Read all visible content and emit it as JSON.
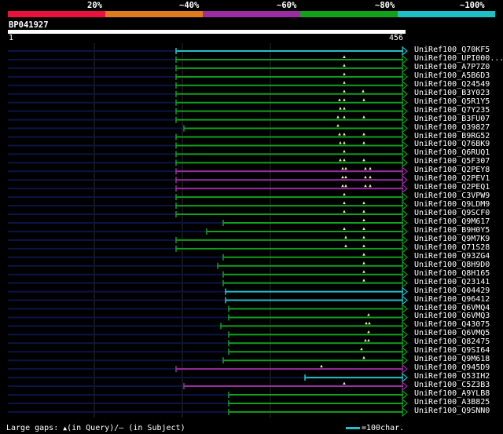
{
  "legend": {
    "colors": [
      "#e8123c",
      "#e07a1e",
      "#9a2ea0",
      "#11a11b",
      "#1fbfc6"
    ],
    "labels": [
      "20%",
      "~40%",
      "~60%",
      "~80%",
      "~100%"
    ]
  },
  "query": {
    "id": "BP041927",
    "start": "1",
    "end": "456"
  },
  "hits": [
    {
      "label": "UniRef100_Q70KF5",
      "start": 224,
      "color": "cyan",
      "marks": []
    },
    {
      "label": "UniRef100_UPI000...",
      "start": 224,
      "color": "green",
      "marks": [
        438
      ]
    },
    {
      "label": "UniRef100_A7P7Z0",
      "start": 224,
      "color": "green",
      "marks": [
        438
      ]
    },
    {
      "label": "UniRef100_A5B6D3",
      "start": 224,
      "color": "green",
      "marks": [
        438
      ]
    },
    {
      "label": "UniRef100_Q24549",
      "start": 224,
      "color": "green",
      "marks": [
        438
      ]
    },
    {
      "label": "UniRef100_B3Y023",
      "start": 224,
      "color": "green",
      "marks": [
        438,
        462
      ]
    },
    {
      "label": "UniRef100_Q5R1Y5",
      "start": 224,
      "color": "green",
      "marks": [
        432,
        438,
        463
      ]
    },
    {
      "label": "UniRef100_Q7Y235",
      "start": 224,
      "color": "green",
      "marks": [
        433,
        438
      ]
    },
    {
      "label": "UniRef100_B3FU07",
      "start": 224,
      "color": "green",
      "marks": [
        430,
        438,
        463
      ]
    },
    {
      "label": "UniRef100_Q39827",
      "start": 234,
      "color": "green",
      "marks": [
        430
      ]
    },
    {
      "label": "UniRef100_B9RG52",
      "start": 224,
      "color": "green",
      "marks": [
        432,
        438,
        463
      ]
    },
    {
      "label": "UniRef100_Q76BK9",
      "start": 224,
      "color": "green",
      "marks": [
        433,
        438,
        463
      ]
    },
    {
      "label": "UniRef100_Q6RUQ1",
      "start": 224,
      "color": "green",
      "marks": [
        438
      ]
    },
    {
      "label": "UniRef100_Q5F307",
      "start": 224,
      "color": "green",
      "marks": [
        433,
        438,
        463
      ]
    },
    {
      "label": "UniRef100_Q2PEY8",
      "start": 224,
      "color": "magenta",
      "marks": [
        436,
        440,
        465,
        471
      ]
    },
    {
      "label": "UniRef100_Q2PEV1",
      "start": 224,
      "color": "magenta",
      "marks": [
        436,
        440,
        465,
        471
      ]
    },
    {
      "label": "UniRef100_Q2PEQ1",
      "start": 224,
      "color": "magenta",
      "marks": [
        436,
        440,
        465,
        471
      ]
    },
    {
      "label": "UniRef100_C3VPW9",
      "start": 224,
      "color": "green",
      "marks": [
        438
      ]
    },
    {
      "label": "UniRef100_Q9LDM9",
      "start": 224,
      "color": "green",
      "marks": [
        438,
        463
      ]
    },
    {
      "label": "UniRef100_Q9SCF0",
      "start": 224,
      "color": "green",
      "marks": [
        438,
        463
      ]
    },
    {
      "label": "UniRef100_Q9M617",
      "start": 284,
      "color": "green",
      "marks": [
        463
      ]
    },
    {
      "label": "UniRef100_B9H0Y5",
      "start": 263,
      "color": "green",
      "marks": [
        438,
        463
      ]
    },
    {
      "label": "UniRef100_Q9M7K9",
      "start": 224,
      "color": "green",
      "marks": [
        440,
        463
      ]
    },
    {
      "label": "UniRef100_Q71S28",
      "start": 224,
      "color": "green",
      "marks": [
        440,
        463
      ]
    },
    {
      "label": "UniRef100_Q93ZG4",
      "start": 284,
      "color": "green",
      "marks": [
        463
      ]
    },
    {
      "label": "UniRef100_Q8H9D0",
      "start": 277,
      "color": "green",
      "marks": [
        463
      ]
    },
    {
      "label": "UniRef100_Q8H165",
      "start": 284,
      "color": "green",
      "marks": [
        463
      ]
    },
    {
      "label": "UniRef100_Q23141",
      "start": 284,
      "color": "green",
      "marks": [
        463
      ]
    },
    {
      "label": "UniRef100_Q04429",
      "start": 287,
      "color": "cyan",
      "marks": []
    },
    {
      "label": "UniRef100_Q96412",
      "start": 287,
      "color": "cyan",
      "marks": []
    },
    {
      "label": "UniRef100_Q6VMQ4",
      "start": 291,
      "color": "green",
      "marks": []
    },
    {
      "label": "UniRef100_Q6VMQ3",
      "start": 291,
      "color": "green",
      "marks": [
        469
      ]
    },
    {
      "label": "UniRef100_Q43075",
      "start": 281,
      "color": "green",
      "marks": [
        466,
        470
      ]
    },
    {
      "label": "UniRef100_Q6VMQ5",
      "start": 291,
      "color": "green",
      "marks": [
        469
      ]
    },
    {
      "label": "UniRef100_Q82475",
      "start": 291,
      "color": "green",
      "marks": [
        465,
        469
      ]
    },
    {
      "label": "UniRef100_Q9SI64",
      "start": 291,
      "color": "green",
      "marks": [
        460
      ]
    },
    {
      "label": "UniRef100_Q9M618",
      "start": 284,
      "color": "green",
      "marks": [
        463
      ]
    },
    {
      "label": "UniRef100_Q945D9",
      "start": 224,
      "color": "magenta",
      "marks": [
        409
      ]
    },
    {
      "label": "UniRef100_Q53IH2",
      "start": 388,
      "color": "cyan",
      "marks": []
    },
    {
      "label": "UniRef100_C5Z3B3",
      "start": 234,
      "color": "magenta",
      "marks": [
        438
      ]
    },
    {
      "label": "UniRef100_A9YLB8",
      "start": 291,
      "color": "green",
      "marks": []
    },
    {
      "label": "UniRef100_A3B825",
      "start": 291,
      "color": "green",
      "marks": []
    },
    {
      "label": "UniRef100_Q9SNN0",
      "start": 291,
      "color": "green",
      "marks": []
    }
  ],
  "footer": {
    "gaps_prefix": "Large gaps: ",
    "gaps_text": "(in Query)/– (in Subject)",
    "scale_text": "=100char."
  }
}
